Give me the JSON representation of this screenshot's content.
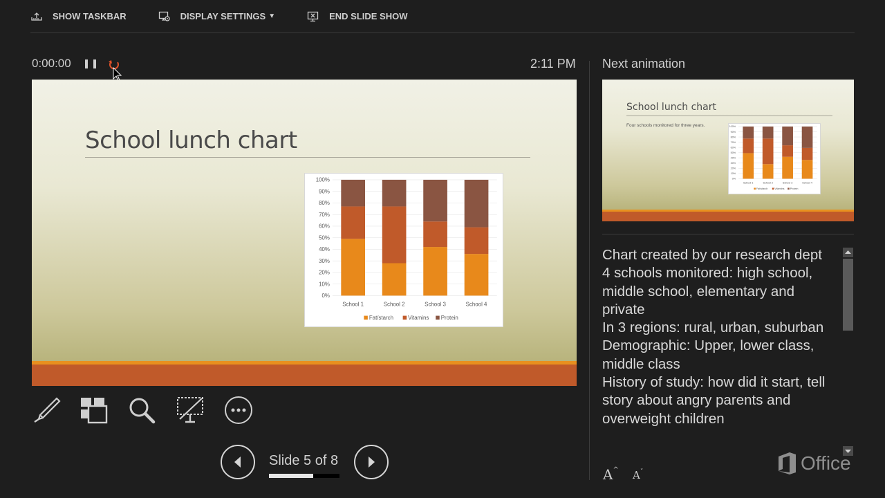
{
  "toolbar": {
    "show_taskbar": "SHOW TASKBAR",
    "display_settings": "DISPLAY SETTINGS",
    "end_slide_show": "END SLIDE SHOW"
  },
  "presenter": {
    "timer": "0:00:00",
    "clock": "2:11 PM"
  },
  "current_slide": {
    "title": "School lunch chart"
  },
  "chart_data": {
    "type": "bar",
    "stacked": true,
    "categories": [
      "School 1",
      "School 2",
      "School 3",
      "School 4"
    ],
    "series": [
      {
        "name": "Fat/starch",
        "values": [
          49,
          28,
          42,
          36
        ],
        "color": "#e8891b"
      },
      {
        "name": "Vitamins",
        "values": [
          28,
          49,
          22,
          23
        ],
        "color": "#c05a2a"
      },
      {
        "name": "Protein",
        "values": [
          23,
          23,
          36,
          41
        ],
        "color": "#8a5542"
      }
    ],
    "y_ticks": [
      "0%",
      "10%",
      "20%",
      "30%",
      "40%",
      "50%",
      "60%",
      "70%",
      "80%",
      "90%",
      "100%"
    ],
    "ylim": [
      0,
      100
    ],
    "legend": "bottom"
  },
  "navigation": {
    "slide_counter": "Slide 5 of 8",
    "progress": 0.625
  },
  "next": {
    "label": "Next animation",
    "title": "School lunch chart",
    "subtitle": "Four schools monitored for three years."
  },
  "notes": [
    "Chart created by our research dept",
    "4 schools monitored: high school, middle school, elementary and private",
    "In 3 regions: rural, urban, suburban",
    "Demographic: Upper, lower class, middle class",
    "History of study: how did it start, tell story about angry parents and overweight children"
  ],
  "font_controls": {
    "increase": "A",
    "decrease": "A"
  },
  "brand": {
    "name": "Office"
  },
  "icons": [
    "taskbar-icon",
    "display-settings-icon",
    "end-show-icon",
    "pause-icon",
    "reset-icon",
    "pen-icon",
    "slides-grid-icon",
    "zoom-icon",
    "black-screen-icon",
    "more-options-icon",
    "previous-icon",
    "next-icon",
    "office-logo-icon"
  ]
}
